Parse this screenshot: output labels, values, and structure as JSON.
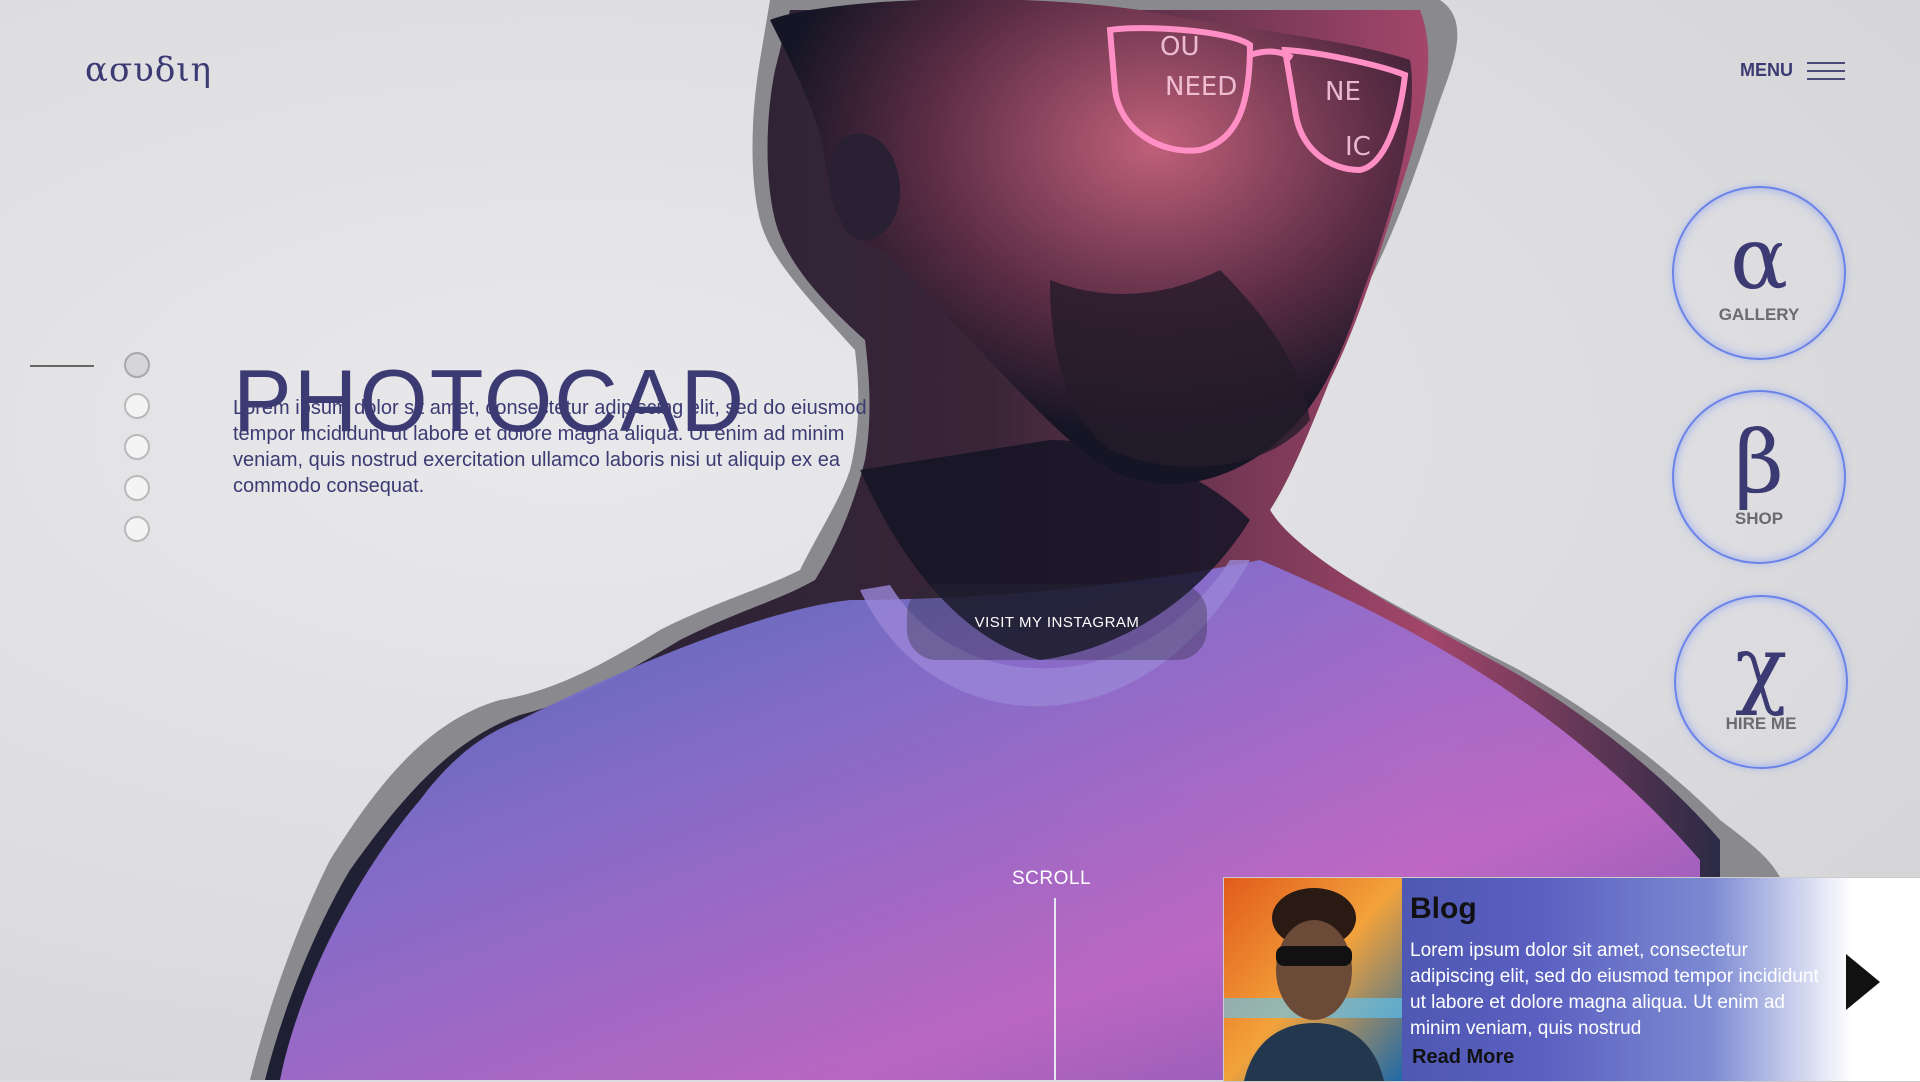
{
  "brand": {
    "logo": "ασυδιη"
  },
  "nav": {
    "menu_label": "MENU"
  },
  "hero": {
    "title": "PHOTOCAD",
    "intro": "Lorem ipsum dolor sit amet, consectetur adipiscing elit, sed do eiusmod tempor incididunt ut labore et dolore magna aliqua. Ut enim ad minim veniam, quis nostrud exercitation ullamco laboris nisi ut aliquip ex ea commodo consequat.",
    "cta": "VISIT MY INSTAGRAM",
    "scroll_label": "SCROLL",
    "slide_count": 5,
    "active_slide": 1
  },
  "side_links": [
    {
      "glyph": "α",
      "label": "GALLERY"
    },
    {
      "glyph": "β",
      "label": "SHOP"
    },
    {
      "glyph": "χ",
      "label": "HIRE ME"
    }
  ],
  "blog": {
    "title": "Blog",
    "excerpt": "Lorem ipsum dolor sit amet, consectetur adipiscing elit, sed do eiusmod tempor incididunt ut labore et dolore magna aliqua. Ut enim ad minim veniam, quis nostrud",
    "read_more": "Read More"
  },
  "colors": {
    "accent": "#3c3a73",
    "ring": "#6a83e8"
  }
}
